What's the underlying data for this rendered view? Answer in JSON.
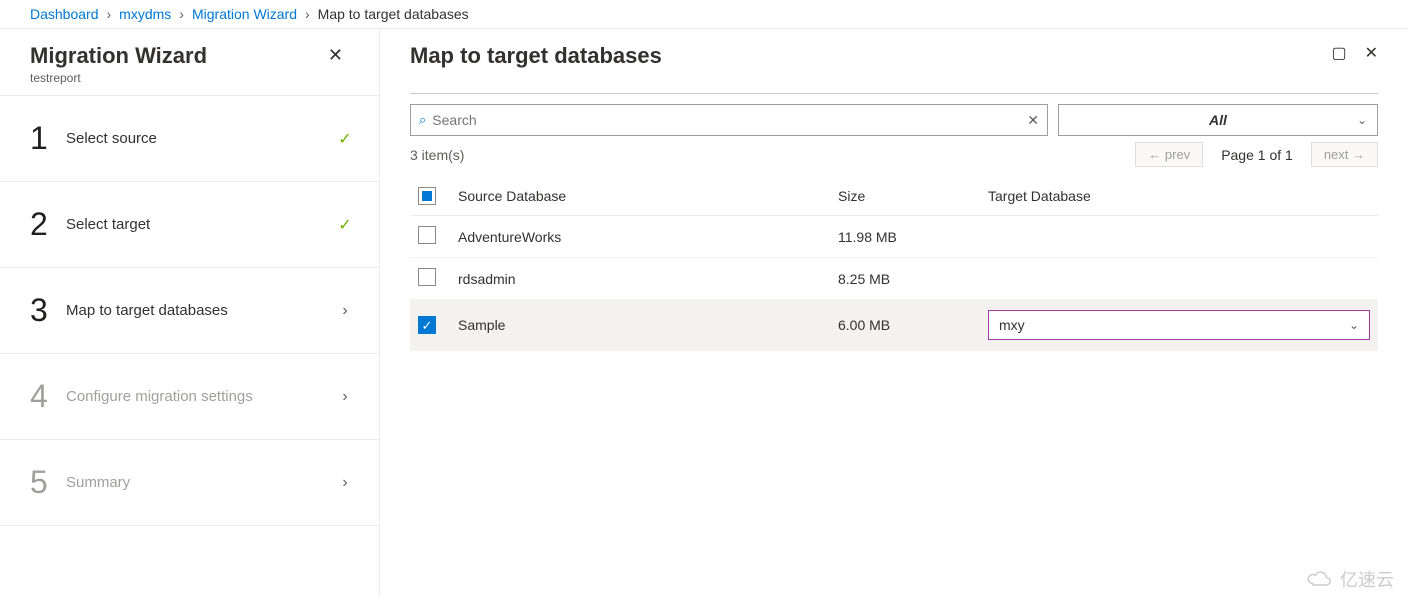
{
  "breadcrumb": {
    "items": [
      "Dashboard",
      "mxydms",
      "Migration Wizard"
    ],
    "current": "Map to target databases"
  },
  "sidebar": {
    "title": "Migration Wizard",
    "subtitle": "testreport",
    "steps": [
      {
        "num": "1",
        "label": "Select source",
        "state": "done"
      },
      {
        "num": "2",
        "label": "Select target",
        "state": "done"
      },
      {
        "num": "3",
        "label": "Map to target databases",
        "state": "current"
      },
      {
        "num": "4",
        "label": "Configure migration settings",
        "state": "pending"
      },
      {
        "num": "5",
        "label": "Summary",
        "state": "pending"
      }
    ]
  },
  "main": {
    "title": "Map to target databases",
    "search_placeholder": "Search",
    "filter_label": "All",
    "item_count": "3 item(s)",
    "pager": {
      "prev": "← prev",
      "info": "Page 1 of 1",
      "next": "next →"
    },
    "columns": {
      "source": "Source Database",
      "size": "Size",
      "target": "Target Database"
    },
    "rows": [
      {
        "checked": false,
        "source": "AdventureWorks",
        "size": "11.98 MB",
        "target": ""
      },
      {
        "checked": false,
        "source": "rdsadmin",
        "size": "8.25 MB",
        "target": ""
      },
      {
        "checked": true,
        "source": "Sample",
        "size": "6.00 MB",
        "target": "mxy"
      }
    ]
  },
  "watermark": "亿速云"
}
